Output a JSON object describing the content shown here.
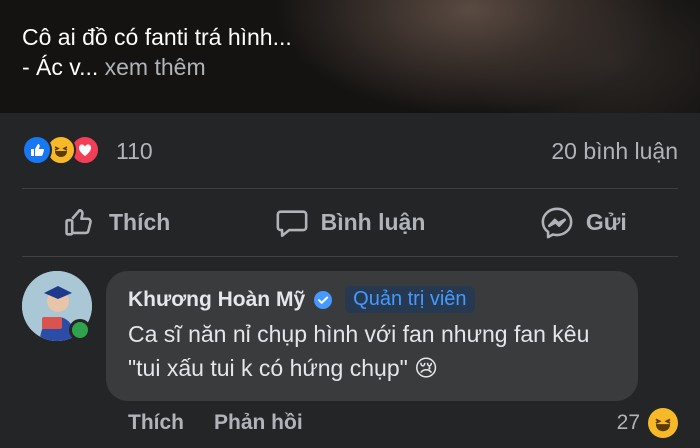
{
  "post": {
    "caption_line1": "Cô ai đồ có fanti trá hình...",
    "caption_line2": "- Ác v...",
    "see_more": "xem thêm"
  },
  "reactions": {
    "icons": [
      "like-icon",
      "haha-icon",
      "love-icon"
    ],
    "count": "110",
    "comments_count": "20 bình luận"
  },
  "actions": {
    "like": "Thích",
    "comment": "Bình luận",
    "send": "Gửi"
  },
  "comment": {
    "author": "Khương Hoàn Mỹ",
    "badge": "Quản trị viên",
    "text": "Ca sĩ năn nỉ chụp hình với fan nhưng fan kêu \"tui xấu tui k có hứng chụp\" 😢",
    "like_label": "Thích",
    "reply_label": "Phản hồi",
    "reaction_count": "27"
  },
  "colors": {
    "background": "#242526",
    "bubble": "#3a3b3c",
    "text": "#e4e6eb",
    "muted": "#b0b3b8",
    "like_blue": "#1877f2",
    "haha_yellow": "#f7b928",
    "love_red": "#f33e58",
    "online_green": "#31a24c",
    "badge_blue": "#4599ff"
  }
}
